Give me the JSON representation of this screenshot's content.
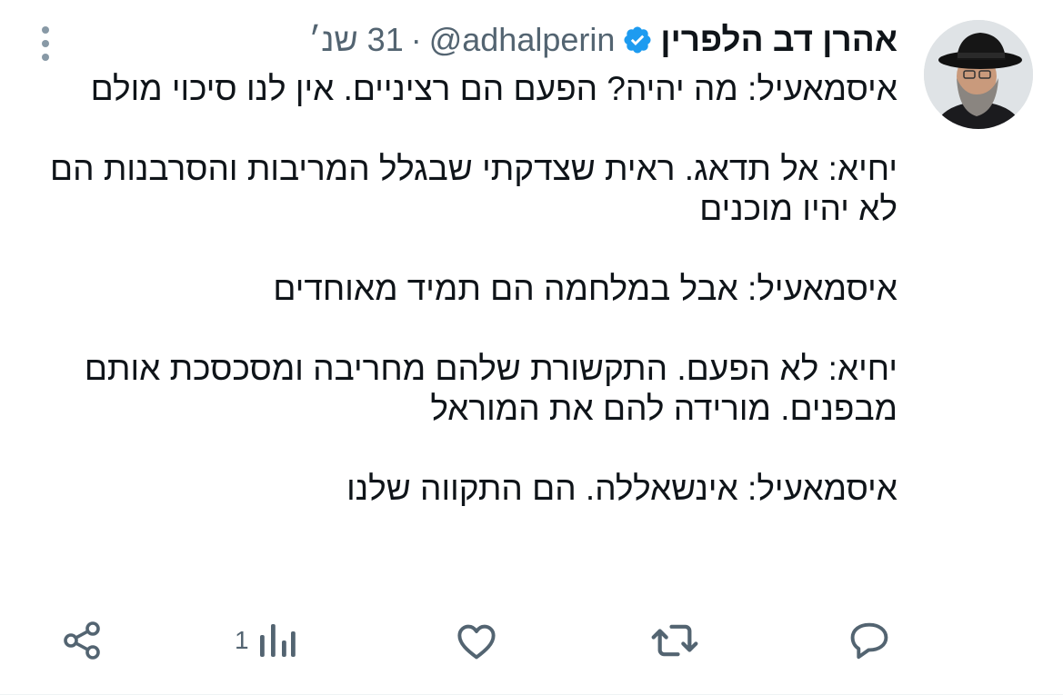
{
  "tweet": {
    "display_name": "אהרן דב הלפרין",
    "handle": "@adhalperin",
    "separator": "·",
    "time": "31 שנ׳",
    "text": "איסמאעיל: מה יהיה? הפעם הם רציניים. אין לנו סיכוי מולם\n\nיחיא: אל תדאג. ראית שצדקתי שבגלל המריבות והסרבנות הם לא יהיו מוכנים\n\nאיסמאעיל: אבל במלחמה הם תמיד מאוחדים\n\nיחיא: לא הפעם. התקשורת שלהם מחריבה ומסכסכת אותם מבפנים. מורידה להם את המוראל\n\nאיסמאעיל: אינשאללה. הם התקווה שלנו"
  },
  "actions": {
    "reply_icon": "reply-icon",
    "retweet_icon": "retweet-icon",
    "like_icon": "heart-icon",
    "views_icon": "views-icon",
    "views_count": "1",
    "share_icon": "share-icon"
  },
  "colors": {
    "text": "#0f1419",
    "secondary": "#536471",
    "verified": "#1d9bf0",
    "icon": "#536471"
  }
}
